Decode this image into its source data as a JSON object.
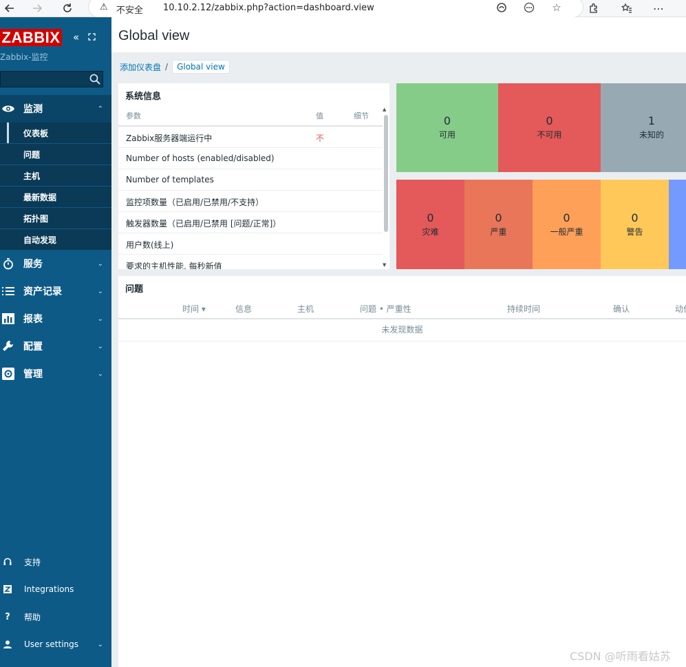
{
  "browser": {
    "not_secure_label": "不安全",
    "url": "10.10.2.12/zabbix.php?action=dashboard.view"
  },
  "sidebar": {
    "logo": "ZABBIX",
    "server_name": "Zabbix-监控",
    "search_placeholder": "",
    "menu": {
      "monitoring": "监测",
      "services": "服务",
      "inventory": "资产记录",
      "reports": "报表",
      "configuration": "配置",
      "administration": "管理"
    },
    "monitoring_items": [
      "仪表板",
      "问题",
      "主机",
      "最新数据",
      "拓扑图",
      "自动发现"
    ],
    "bottom": {
      "support": "支持",
      "integrations": "Integrations",
      "help": "帮助",
      "user_settings": "User settings"
    }
  },
  "header": {
    "title": "Global view"
  },
  "breadcrumb": {
    "parent": "添加仪表盘",
    "current": "Global view"
  },
  "system_info": {
    "title": "系统信息",
    "columns": {
      "param": "参数",
      "value": "值",
      "details": "细节"
    },
    "rows": [
      {
        "param": "Zabbix服务器端运行中",
        "value": "不"
      },
      {
        "param": "Number of hosts (enabled/disabled)",
        "value": ""
      },
      {
        "param": "Number of templates",
        "value": ""
      },
      {
        "param": "监控项数量（已启用/已禁用/不支持）",
        "value": ""
      },
      {
        "param": "触发器数量（已启用/已禁用 [问题/正常]）",
        "value": ""
      },
      {
        "param": "用户数(线上)",
        "value": ""
      },
      {
        "param": "要求的主机性能, 每秒新值",
        "value": ""
      }
    ]
  },
  "host_availability": [
    {
      "count": "0",
      "label": "可用",
      "color": "#86cc89"
    },
    {
      "count": "0",
      "label": "不可用",
      "color": "#e45959"
    },
    {
      "count": "1",
      "label": "未知的",
      "color": "#97aab3"
    }
  ],
  "problems_by_severity": [
    {
      "count": "0",
      "label": "灾难",
      "color": "#e45959"
    },
    {
      "count": "0",
      "label": "严重",
      "color": "#e97659"
    },
    {
      "count": "0",
      "label": "一般严重",
      "color": "#ffa059"
    },
    {
      "count": "0",
      "label": "警告",
      "color": "#ffc859"
    }
  ],
  "problems": {
    "title": "问题",
    "columns": {
      "time": "时间 ▾",
      "info": "信息",
      "host": "主机",
      "problem_severity": "问题 • 严重性",
      "duration": "持续时间",
      "ack": "确认",
      "actions": "动作"
    },
    "empty": "未发现数据"
  },
  "watermark": "CSDN @听雨看姑苏"
}
